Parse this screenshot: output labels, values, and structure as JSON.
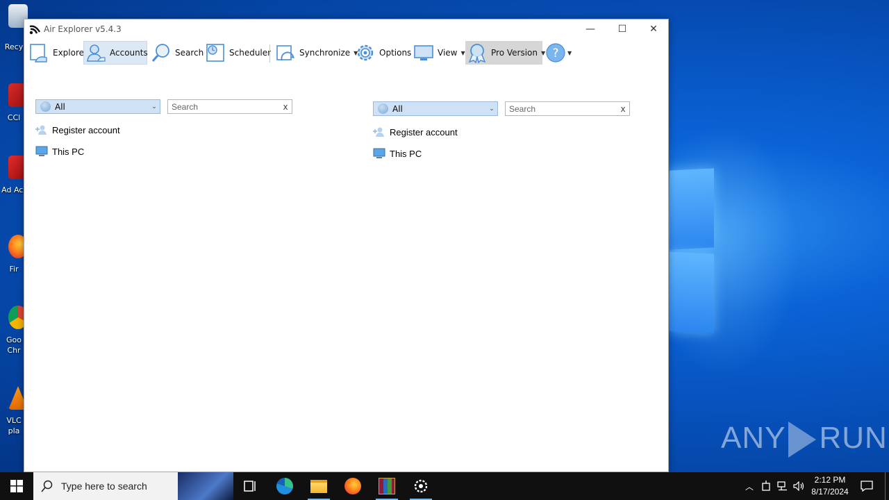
{
  "window": {
    "title": "Air Explorer v5.4.3",
    "controls": {
      "minimize": "—",
      "maximize": "☐",
      "close": "✕"
    }
  },
  "toolbar": {
    "explore": "Explore",
    "accounts": "Accounts",
    "search": "Search",
    "scheduler": "Scheduler",
    "synchronize": "Synchronize",
    "options": "Options",
    "view": "View",
    "pro_version": "Pro Version",
    "dropdown_glyph": "▼"
  },
  "left_panel": {
    "filter_value": "All",
    "search_placeholder": "Search",
    "clear": "x",
    "items": [
      {
        "label": "Register account",
        "icon": "add-user-icon"
      },
      {
        "label": "This PC",
        "icon": "computer-icon"
      }
    ]
  },
  "right_panel": {
    "filter_value": "All",
    "search_placeholder": "Search",
    "clear": "x",
    "items": [
      {
        "label": "Register account",
        "icon": "add-user-icon"
      },
      {
        "label": "This PC",
        "icon": "computer-icon"
      }
    ]
  },
  "desktop": {
    "icons": [
      {
        "label": "Recy",
        "icon": "recycle-bin-icon"
      },
      {
        "label": "CCl",
        "icon": "ccleaner-icon"
      },
      {
        "label": "Ad Acr",
        "icon": "acrobat-icon"
      },
      {
        "label": "Fir",
        "icon": "firefox-icon"
      },
      {
        "label": "Goo Chr",
        "icon": "chrome-icon"
      },
      {
        "label": "VLC pla",
        "icon": "vlc-icon"
      }
    ],
    "watermark_left": "ANY",
    "watermark_right": "RUN"
  },
  "taskbar": {
    "search_placeholder": "Type here to search",
    "apps": [
      {
        "name": "task-view-icon"
      },
      {
        "name": "edge-icon"
      },
      {
        "name": "file-explorer-icon"
      },
      {
        "name": "firefox-icon"
      },
      {
        "name": "winrar-icon"
      },
      {
        "name": "air-explorer-icon"
      }
    ],
    "time": "2:12 PM",
    "date": "8/17/2024"
  },
  "colors": {
    "accent_blue": "#2f7fe0",
    "icon_blue": "#4a8fd6",
    "selected_bg": "#dce9f5",
    "filter_bg": "#cfe1f5",
    "taskbar_bg": "#101010"
  }
}
